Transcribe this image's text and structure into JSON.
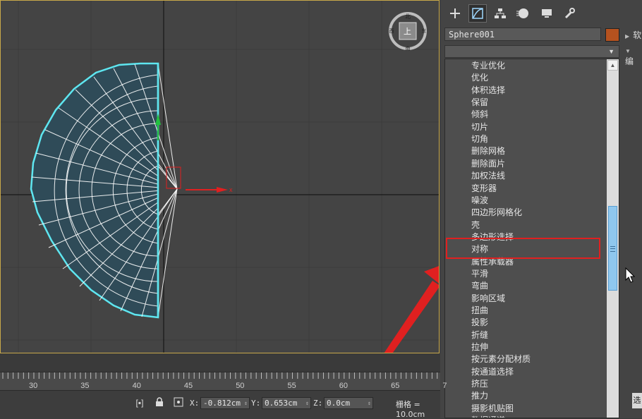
{
  "command_panel": {
    "object_name": "Sphere001",
    "object_color": "#b5521f",
    "tabs": [
      "create-icon",
      "modify-icon",
      "hierarchy-icon",
      "motion-icon",
      "display-icon",
      "utilities-icon"
    ],
    "side_labels": [
      "软",
      "编"
    ],
    "modifier_list_value": ""
  },
  "modifier_list": {
    "items": [
      "专业优化",
      "优化",
      "体积选择",
      "保留",
      "倾斜",
      "切片",
      "切角",
      "删除网格",
      "删除面片",
      "加权法线",
      "变形器",
      "噪波",
      "四边形网格化",
      "壳",
      "多边形选择",
      "对称",
      "属性承载器",
      "平滑",
      "弯曲",
      "影响区域",
      "扭曲",
      "投影",
      "折缝",
      "拉伸",
      "按元素分配材质",
      "按通道选择",
      "挤压",
      "推力",
      "摄影机贴图",
      "数据通道"
    ],
    "highlighted": "对称",
    "scroll_position": 0.45
  },
  "viewport": {
    "viewcube_label": "上"
  },
  "timeline": {
    "ruler_ticks": [
      "30",
      "35",
      "40",
      "45",
      "50",
      "55",
      "60",
      "65",
      "7"
    ]
  },
  "status": {
    "x_label": "X:",
    "x_value": "-0.812cm",
    "y_label": "Y:",
    "y_value": "0.653cm",
    "z_label": "Z:",
    "z_value": "0.0cm",
    "grid_text": "栅格 = 10.0cm",
    "right_button": "选"
  },
  "colors": {
    "selection_outline": "#5ee6f0",
    "annotation_red": "#e02020",
    "gizmo_x": "#e02020",
    "gizmo_y": "#22c040"
  }
}
